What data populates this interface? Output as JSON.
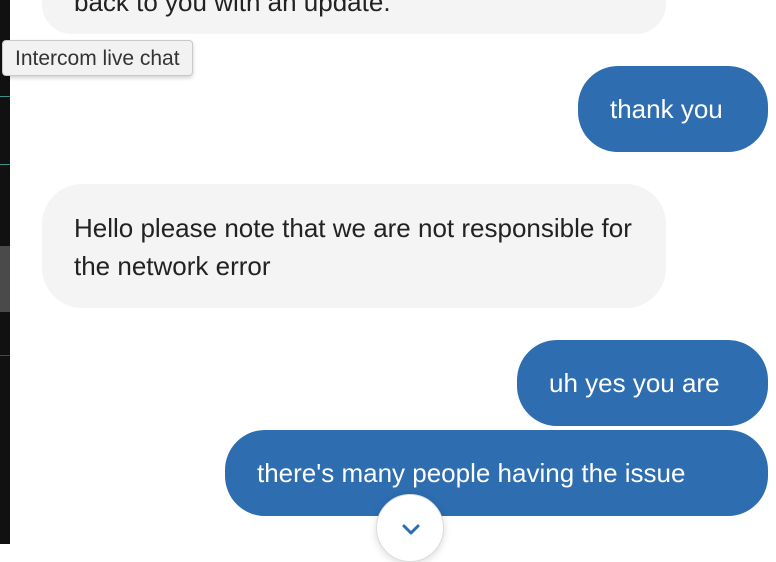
{
  "tooltip": {
    "text": "Intercom live chat"
  },
  "messages": [
    {
      "sender": "agent",
      "text": "back to you with an update."
    },
    {
      "sender": "user",
      "text": "thank you"
    },
    {
      "sender": "agent",
      "text": "Hello please note that we are not responsible for the network error"
    },
    {
      "sender": "user",
      "text": "uh yes you are"
    },
    {
      "sender": "user",
      "text": "there's many people having the issue"
    }
  ],
  "scroll_button": {
    "icon": "chevron-down-icon"
  },
  "colors": {
    "user_bubble": "#2d6db0",
    "agent_bubble": "#f4f4f4",
    "text_dark": "#222222",
    "text_light": "#ffffff",
    "accent": "#2d6db0"
  }
}
